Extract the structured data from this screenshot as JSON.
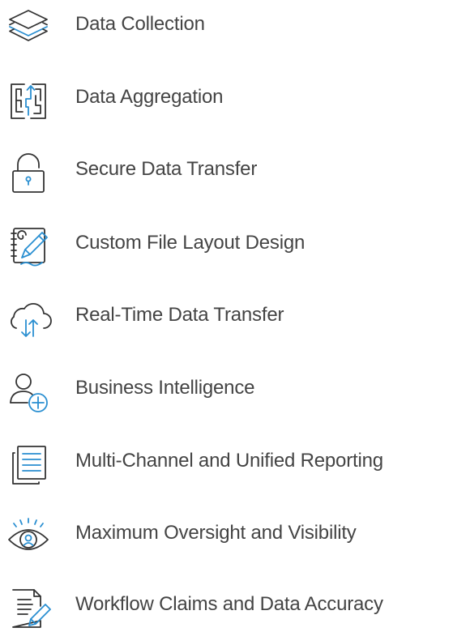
{
  "accent_color": "#2a8fd1",
  "text_color": "#444444",
  "features": [
    {
      "label": "Data Collection",
      "icon": "layers-icon"
    },
    {
      "label": "Data Aggregation",
      "icon": "maze-icon"
    },
    {
      "label": "Secure Data Transfer",
      "icon": "padlock-icon"
    },
    {
      "label": "Custom File Layout Design",
      "icon": "notebook-pen-icon"
    },
    {
      "label": "Real-Time Data Transfer",
      "icon": "cloud-transfer-icon"
    },
    {
      "label": "Business Intelligence",
      "icon": "user-add-icon"
    },
    {
      "label": "Multi-Channel and Unified Reporting",
      "icon": "documents-icon"
    },
    {
      "label": "Maximum Oversight and Visibility",
      "icon": "eye-icon"
    },
    {
      "label": "Workflow Claims and Data Accuracy",
      "icon": "document-edit-icon"
    }
  ]
}
